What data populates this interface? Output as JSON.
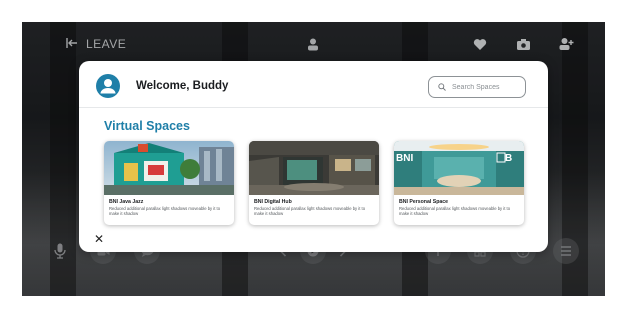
{
  "topbar": {
    "leave_label": "LEAVE",
    "icons": [
      "exit-arrow-icon",
      "user-badge-icon",
      "heart-icon",
      "camera-icon",
      "add-user-icon"
    ]
  },
  "bottombar": {
    "icons": [
      "microphone-icon",
      "video-icon",
      "chat-icon",
      "arrow-left-icon",
      "play-icon",
      "arrow-right-icon",
      "plus-icon",
      "grid-icon",
      "help-icon",
      "menu-icon"
    ]
  },
  "modal": {
    "welcome_text": "Welcome, Buddy",
    "search_placeholder": "Search Spaces",
    "section_title": "Virtual Spaces",
    "close_symbol": "✕",
    "cards": [
      {
        "title": "BNI Java Jazz",
        "description": "Reduced additional parallax light shadows moveable by it to make it shadow",
        "thumb_text": ""
      },
      {
        "title": "BNI Digital Hub",
        "description": "Reduced additional parallax light shadows moveable by it to make it shadow",
        "thumb_text": ""
      },
      {
        "title": "BNI Personal Space",
        "description": "Reduced additional parallax light shadows moveable by it to make it shadow",
        "thumb_text_left": "BNI",
        "thumb_text_right": "B"
      }
    ]
  },
  "colors": {
    "accent": "#1f7fa8",
    "modal_bg": "#ffffff",
    "backdrop": "#26282b"
  }
}
